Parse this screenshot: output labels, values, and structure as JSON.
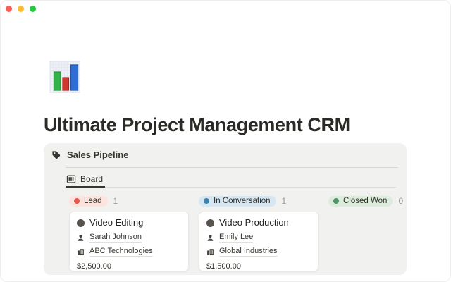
{
  "window": {
    "controls": [
      {
        "name": "close",
        "color": "#ff5f57"
      },
      {
        "name": "minimize",
        "color": "#febc2e"
      },
      {
        "name": "zoom",
        "color": "#28c840"
      }
    ]
  },
  "page": {
    "icon": "bar-chart-emoji",
    "title": "Ultimate Project Management CRM"
  },
  "pipeline": {
    "title": "Sales Pipeline",
    "tab": {
      "label": "Board"
    },
    "columns": [
      {
        "status": "Lead",
        "count": "1",
        "pill_bg": "#fde3dd",
        "dot_color": "#e8574a",
        "cards": [
          {
            "title": "Video Editing",
            "person": "Sarah Johnson",
            "company": "ABC Technologies",
            "amount": "$2,500.00"
          }
        ]
      },
      {
        "status": "In Conversation",
        "count": "1",
        "pill_bg": "#d7e7f2",
        "dot_color": "#3a82ad",
        "cards": [
          {
            "title": "Video Production",
            "person": "Emily Lee",
            "company": "Global Industries",
            "amount": "$1,500.00"
          }
        ]
      },
      {
        "status": "Closed Won",
        "count": "0",
        "pill_bg": "#dcecdc",
        "dot_color": "#4f9768",
        "cards": []
      }
    ]
  }
}
